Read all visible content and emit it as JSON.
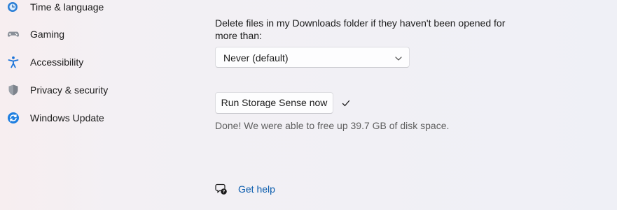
{
  "sidebar": {
    "items": [
      {
        "label": "Time & language",
        "icon": "clock-globe-icon"
      },
      {
        "label": "Gaming",
        "icon": "gamepad-icon"
      },
      {
        "label": "Accessibility",
        "icon": "accessibility-icon"
      },
      {
        "label": "Privacy & security",
        "icon": "shield-icon"
      },
      {
        "label": "Windows Update",
        "icon": "windows-update-icon"
      }
    ]
  },
  "storage_sense": {
    "downloads_description": "Delete files in my Downloads folder if they haven't been opened for more than:",
    "downloads_dropdown_value": "Never (default)",
    "run_button_label": "Run Storage Sense now",
    "status_text": "Done! We were able to free up 39.7 GB of disk space."
  },
  "help": {
    "link_label": "Get help"
  },
  "colors": {
    "accent": "#0a5cad",
    "link": "#0a5cad"
  }
}
